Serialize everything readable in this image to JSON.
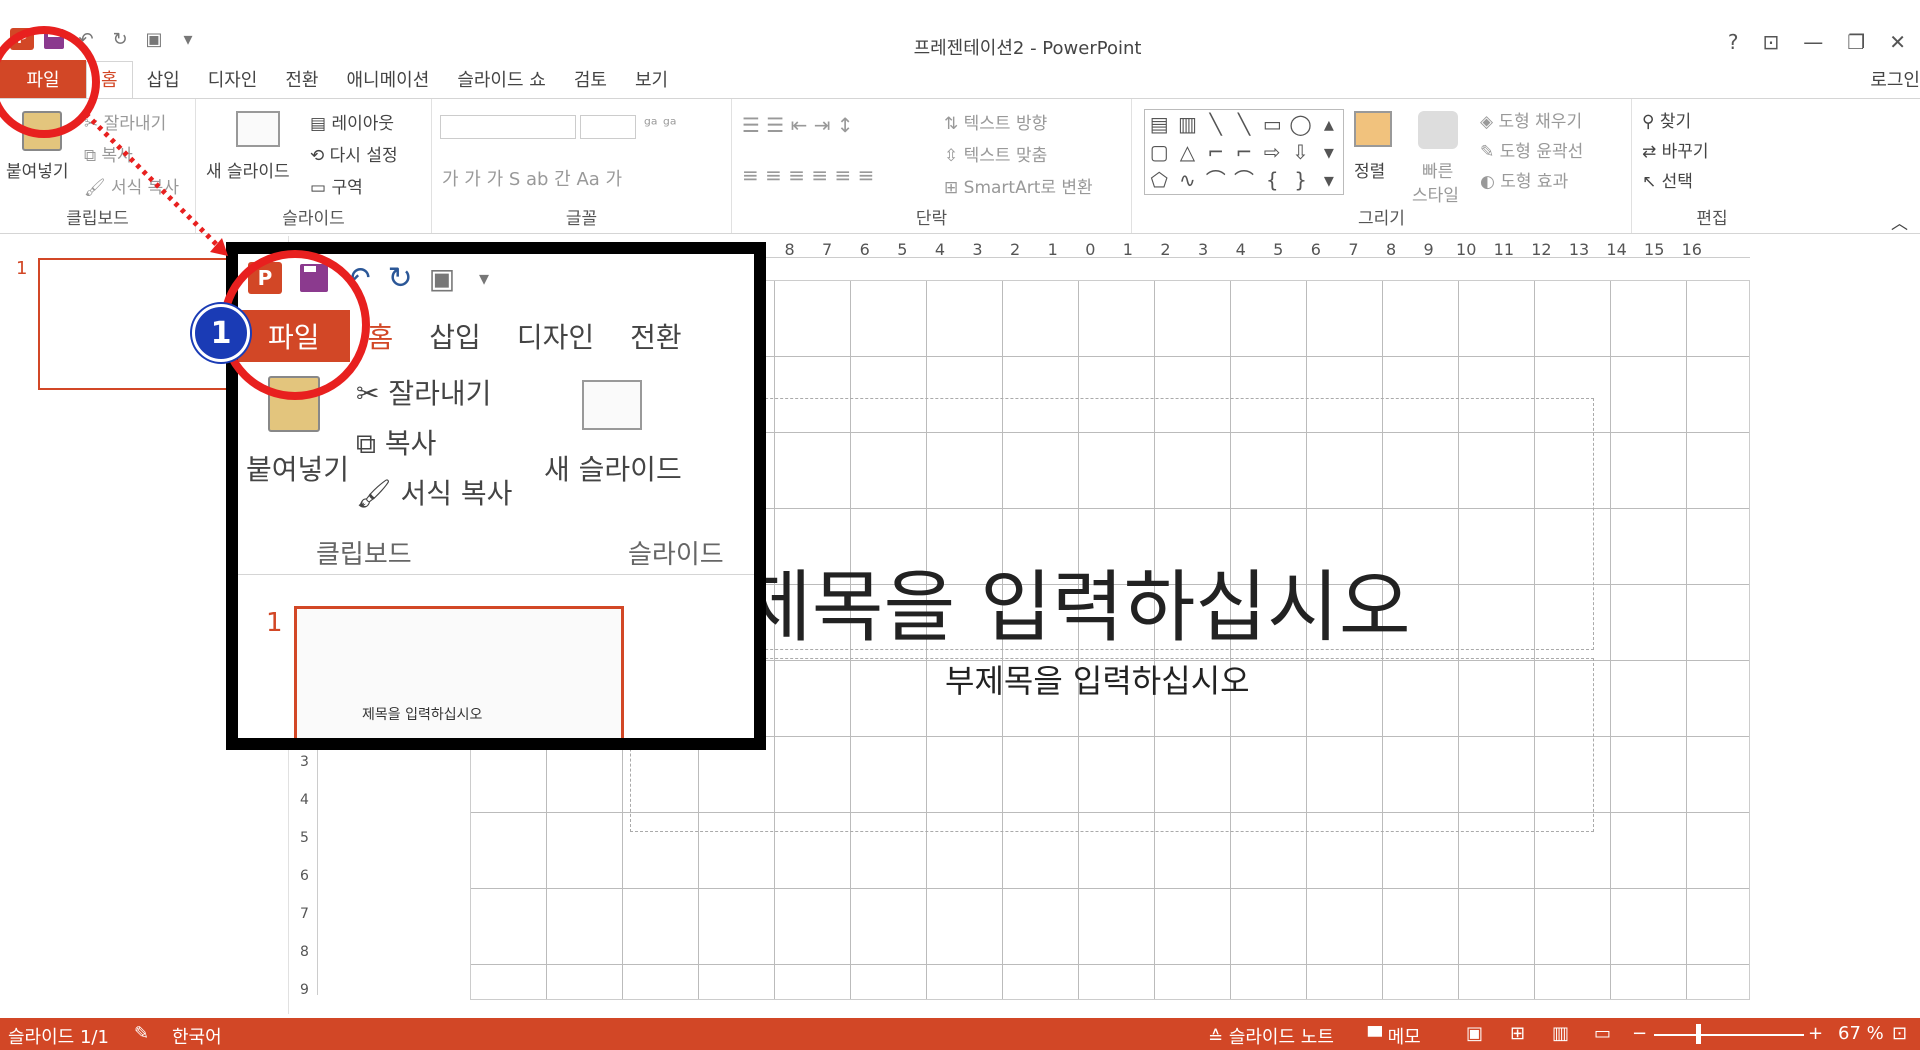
{
  "window": {
    "title": "프레젠테이션2 - PowerPoint",
    "help": "?",
    "login": "로그인"
  },
  "tabs": {
    "file": "파일",
    "home": "홈",
    "insert": "삽입",
    "design": "디자인",
    "transitions": "전환",
    "animations": "애니메이션",
    "slideshow": "슬라이드 쇼",
    "review": "검토",
    "view": "보기"
  },
  "ribbon": {
    "clipboard": {
      "label": "클립보드",
      "paste": "붙여넣기",
      "cut": "잘라내기",
      "copy": "복사",
      "format_painter": "서식 복사"
    },
    "slides": {
      "label": "슬라이드",
      "new_slide": "새 슬라이드",
      "layout": "레이아웃",
      "reset": "다시 설정",
      "section": "구역"
    },
    "font": {
      "label": "글꼴"
    },
    "paragraph": {
      "label": "단락",
      "text_direction": "텍스트 방향",
      "align_text": "텍스트 맞춤",
      "smartart": "SmartArt로 변환"
    },
    "drawing": {
      "label": "그리기",
      "arrange": "정렬",
      "quick_styles_1": "빠른",
      "quick_styles_2": "스타일",
      "shape_fill": "도형 채우기",
      "shape_outline": "도형 윤곽선",
      "shape_effects": "도형 효과"
    },
    "editing": {
      "label": "편집",
      "find": "찾기",
      "replace": "바꾸기",
      "select": "선택"
    }
  },
  "slide_panel": {
    "thumb_number": "1"
  },
  "slide": {
    "title_placeholder": "제목을 입력하십시오",
    "subtitle_placeholder": "부제목을 입력하십시오"
  },
  "annotation": {
    "badge": "1"
  },
  "statusbar": {
    "slide_count": "슬라이드 1/1",
    "language": "한국어",
    "notes": "슬라이드 노트",
    "comments": "메모",
    "zoom": "67 %"
  },
  "colors": {
    "accent": "#d24726",
    "annotation_red": "#e8201f",
    "badge_blue": "#1a3bb5"
  }
}
